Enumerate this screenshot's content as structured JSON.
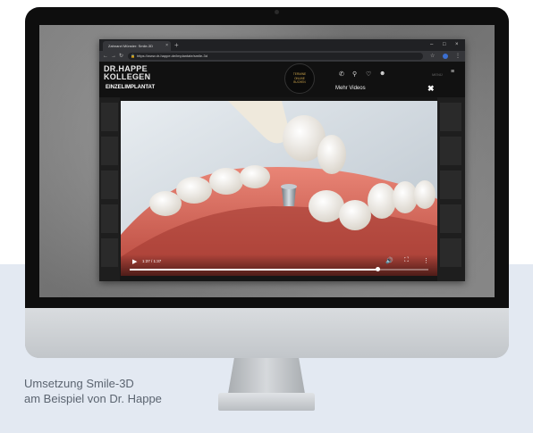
{
  "caption": {
    "line1": "Umsetzung Smile-3D",
    "line2": "am Beispiel von Dr. Happe"
  },
  "browser": {
    "tab_title": "Zahnarzt Münster: Smile-3D",
    "tab_close_icon": "close-icon",
    "new_tab_icon": "plus-icon",
    "url": "https://www.dr-happe.de/implantate/smile-3d",
    "window_controls": [
      "minimize-icon",
      "maximize-icon",
      "close-icon"
    ]
  },
  "site": {
    "logo_line1": "DR.HAPPE",
    "logo_line2": "KOLLEGEN",
    "heading": "EINZELIMPLANTAT",
    "cta_text": "TERMINE ONLINE BUCHEN",
    "more_videos": "Mehr Videos",
    "menu_label": "MENÜ",
    "close_label": "✖"
  },
  "video": {
    "time": "1:37 / 1:37",
    "progress": 0.83
  },
  "colors": {
    "band": "#e3e9f2",
    "caption": "#5b6470",
    "gum": "#d96a5c",
    "tooth": "#f1eee8",
    "implant": "#9aa3ab"
  }
}
